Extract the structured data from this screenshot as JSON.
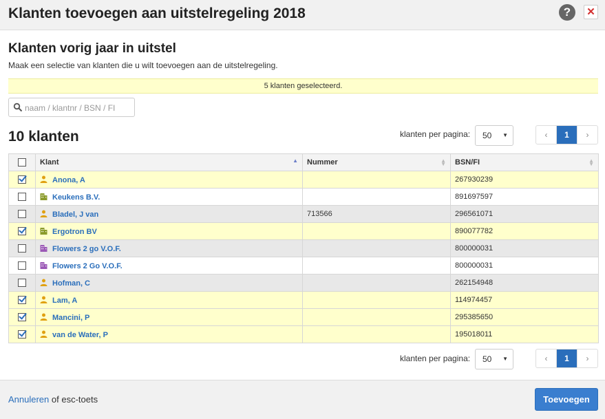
{
  "dialog": {
    "title": "Klanten toevoegen aan uitstelregeling 2018"
  },
  "section": {
    "title": "Klanten vorig jaar in uitstel",
    "description": "Maak een selectie van klanten die u wilt toevoegen aan de uitstelregeling."
  },
  "banner": {
    "text": "5 klanten geselecteerd."
  },
  "search": {
    "placeholder": "naam / klantnr / BSN / FI",
    "value": ""
  },
  "list": {
    "count_label": "10 klanten",
    "per_page_label": "klanten per pagina:",
    "per_page_value": "50",
    "pager": {
      "prev": "‹",
      "current": "1",
      "next": "›"
    }
  },
  "table": {
    "headers": {
      "klant": "Klant",
      "nummer": "Nummer",
      "bsn": "BSN/FI"
    },
    "rows": [
      {
        "checked": true,
        "type": "person",
        "name": "Anona, A",
        "nummer": "",
        "bsn": "267930239",
        "style": "sel"
      },
      {
        "checked": false,
        "type": "company",
        "name": "Keukens B.V.",
        "nummer": "",
        "bsn": "891697597",
        "style": "plain"
      },
      {
        "checked": false,
        "type": "person",
        "name": "Bladel, J van",
        "nummer": "713566",
        "bsn": "296561071",
        "style": "alt"
      },
      {
        "checked": true,
        "type": "company",
        "name": "Ergotron BV",
        "nummer": "",
        "bsn": "890077782",
        "style": "sel"
      },
      {
        "checked": false,
        "type": "partnership",
        "name": "Flowers 2 go V.O.F.",
        "nummer": "",
        "bsn": "800000031",
        "style": "alt"
      },
      {
        "checked": false,
        "type": "partnership",
        "name": "Flowers 2 Go V.O.F.",
        "nummer": "",
        "bsn": "800000031",
        "style": "plain"
      },
      {
        "checked": false,
        "type": "person",
        "name": "Hofman, C",
        "nummer": "",
        "bsn": "262154948",
        "style": "alt"
      },
      {
        "checked": true,
        "type": "person",
        "name": "Lam, A",
        "nummer": "",
        "bsn": "114974457",
        "style": "sel"
      },
      {
        "checked": true,
        "type": "person",
        "name": "Mancini, P",
        "nummer": "",
        "bsn": "295385650",
        "style": "sel"
      },
      {
        "checked": true,
        "type": "person",
        "name": "van de Water, P",
        "nummer": "",
        "bsn": "195018011",
        "style": "sel"
      }
    ]
  },
  "footer": {
    "cancel_link": "Annuleren",
    "cancel_suffix": " of esc-toets",
    "add_button": "Toevoegen"
  },
  "colors": {
    "accent": "#2a6ebb",
    "selected_row": "#ffffcc",
    "person_icon": "#e0a010",
    "company_icon": "#8a9a2a",
    "partnership_icon": "#9b59b6"
  },
  "icons": {
    "person": "person-icon",
    "company": "building-icon",
    "partnership": "building-icon"
  }
}
